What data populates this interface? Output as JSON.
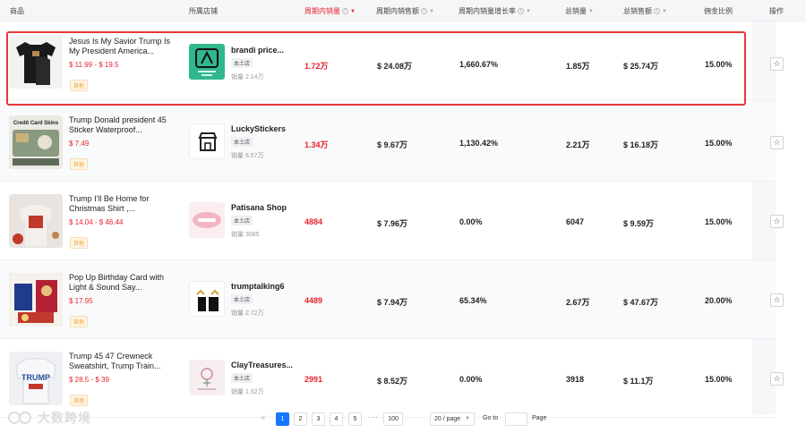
{
  "header": {
    "product": "商品",
    "shop": "所属店铺",
    "period_sales": "周期内销量",
    "period_revenue": "周期内销售额",
    "period_growth": "周期内销量增长率",
    "total_sales": "总销量",
    "total_revenue": "总销售额",
    "commission": "佣金比例",
    "action": "操作"
  },
  "rows": [
    {
      "name": "Jesus Is My Savior Trump Is My President America...",
      "price": "$ 11.99 - $ 19.5",
      "tag": "其他",
      "shop_name": "brandi price...",
      "shop_type": "本土店",
      "shop_sales": "销量 2.14万",
      "period_sales": "1.72万",
      "period_revenue": "$ 24.08万",
      "growth": "1,660.67%",
      "total_sales": "1.85万",
      "total_revenue": "$ 25.74万",
      "commission": "15.00%"
    },
    {
      "name": "Trump Donald president 45 Sticker Waterproof...",
      "price": "$ 7.49",
      "tag": "其他",
      "thumb_text": "Credit Card Skins",
      "shop_name": "LuckyStickers",
      "shop_type": "本土店",
      "shop_sales": "销量 6.57万",
      "period_sales": "1.34万",
      "period_revenue": "$ 9.67万",
      "growth": "1,130.42%",
      "total_sales": "2.21万",
      "total_revenue": "$ 16.18万",
      "commission": "15.00%"
    },
    {
      "name": "Trump I'll Be Home for Christmas Shirt ,...",
      "price": "$ 14.04 - $ 46.44",
      "tag": "其他",
      "shop_name": "Patisana Shop",
      "shop_type": "本土店",
      "shop_sales": "销量 3085",
      "period_sales": "4884",
      "period_revenue": "$ 7.96万",
      "growth": "0.00%",
      "total_sales": "6047",
      "total_revenue": "$ 9.59万",
      "commission": "15.00%"
    },
    {
      "name": "Pop Up Birthday Card with Light & Sound Say...",
      "price": "$ 17.95",
      "tag": "其他",
      "shop_name": "trumptalking6",
      "shop_type": "本土店",
      "shop_sales": "销量 2.72万",
      "period_sales": "4489",
      "period_revenue": "$ 7.94万",
      "growth": "65.34%",
      "total_sales": "2.67万",
      "total_revenue": "$ 47.67万",
      "commission": "20.00%"
    },
    {
      "name": "Trump 45 47 Crewneck Sweatshirt, Trump Train...",
      "price": "$ 28.5 - $ 39",
      "tag": "其他",
      "thumb_text": "TRUMP",
      "shop_name": "ClayTreasures...",
      "shop_type": "本土店",
      "shop_sales": "销量 1.52万",
      "period_sales": "2991",
      "period_revenue": "$ 8.52万",
      "growth": "0.00%",
      "total_sales": "3918",
      "total_revenue": "$ 11.1万",
      "commission": "15.00%"
    }
  ],
  "pagination": {
    "prev": "<",
    "pages": [
      "1",
      "2",
      "3",
      "4",
      "5"
    ],
    "dots": "···",
    "last": "100",
    "page_size": "20 / page",
    "goto": "Go to",
    "page_label": "Page"
  },
  "watermark": {
    "text": "大数跨境"
  },
  "colors": {
    "accent_red": "#e8222e",
    "primary_blue": "#1677ff",
    "tag_orange": "#e8a33a"
  }
}
